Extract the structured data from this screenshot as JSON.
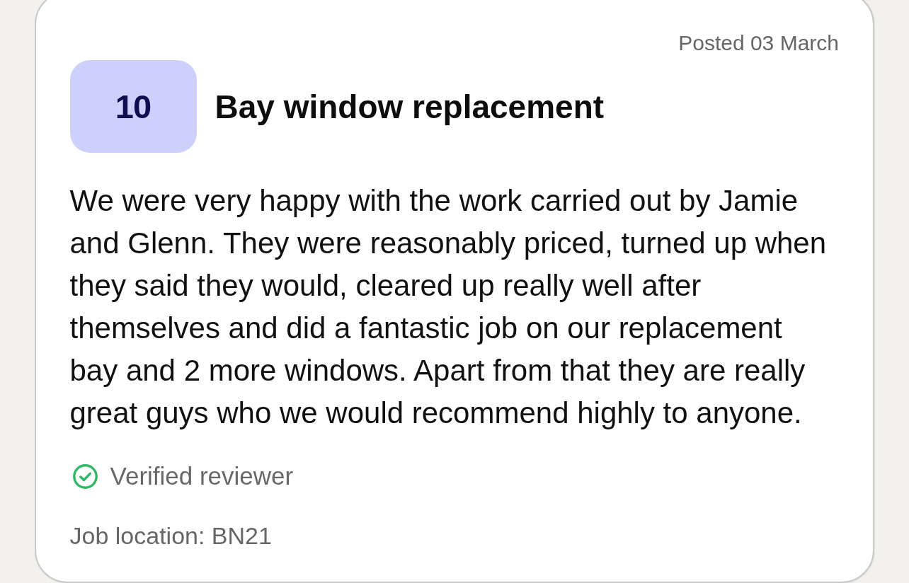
{
  "review": {
    "posted": "Posted 03 March",
    "score": "10",
    "title": "Bay window replacement",
    "body": "We were very happy with the work carried out by Jamie and Glenn. They were reasonably priced, turned up when they said they would, cleared up really well after themselves and did a fantastic job on our replacement bay and 2 more windows. Apart from that they are really great guys who we would recommend highly to anyone.",
    "verified": true,
    "verified_label": "Verified reviewer",
    "job_location": "Job location: BN21"
  }
}
